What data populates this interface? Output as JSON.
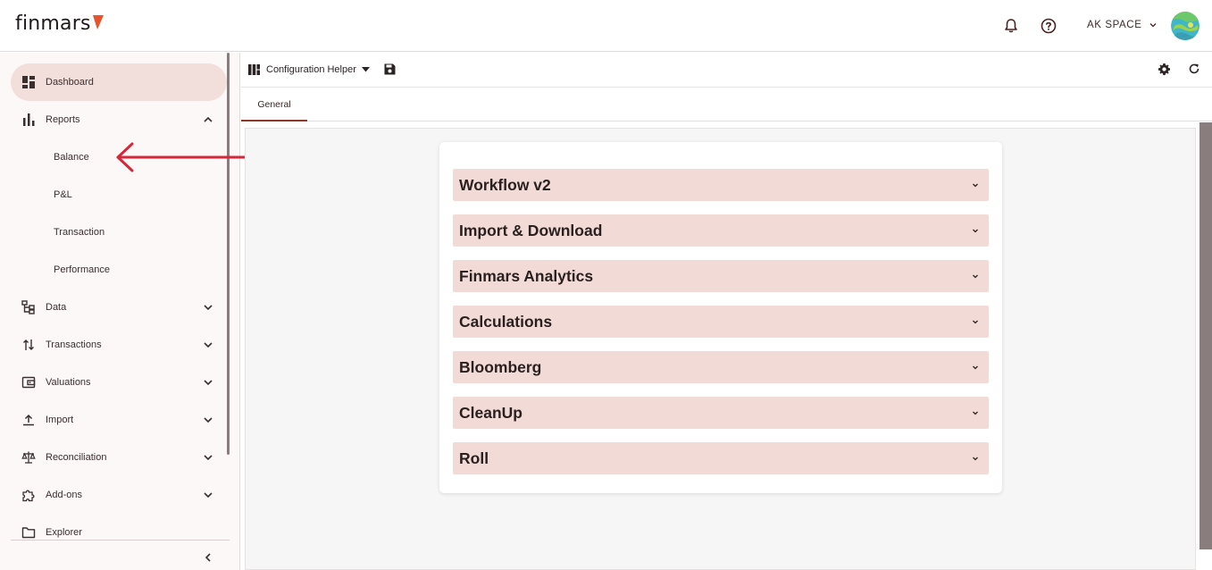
{
  "brand": {
    "logo_text": "finmars"
  },
  "header": {
    "space_name": "AK SPACE",
    "icons": [
      "bell-icon",
      "help-icon",
      "chevron-down-icon",
      "avatar"
    ]
  },
  "sidebar": {
    "items": [
      {
        "label": "Dashboard",
        "icon": "dashboard-icon",
        "active": true
      },
      {
        "label": "Reports",
        "icon": "bar-chart-icon",
        "expanded": true
      },
      {
        "label": "Data",
        "icon": "data-tree-icon"
      },
      {
        "label": "Transactions",
        "icon": "swap-vertical-icon"
      },
      {
        "label": "Valuations",
        "icon": "wallet-icon"
      },
      {
        "label": "Import",
        "icon": "upload-icon"
      },
      {
        "label": "Reconciliation",
        "icon": "scale-icon"
      },
      {
        "label": "Add-ons",
        "icon": "puzzle-icon"
      },
      {
        "label": "Explorer",
        "icon": "folder-icon"
      }
    ],
    "report_sub_items": [
      "Balance",
      "P&L",
      "Transaction",
      "Performance"
    ]
  },
  "toolbar": {
    "title": "Configuration Helper"
  },
  "tabs": [
    {
      "label": "General",
      "active": true
    }
  ],
  "accordion": {
    "sections": [
      {
        "title": "Workflow v2"
      },
      {
        "title": "Import & Download"
      },
      {
        "title": "Finmars Analytics"
      },
      {
        "title": "Calculations"
      },
      {
        "title": "Bloomberg"
      },
      {
        "title": "CleanUp"
      },
      {
        "title": "Roll"
      }
    ]
  },
  "colors": {
    "accent": "#e8522d",
    "active_bg": "#f2dedb",
    "accordion_bg": "#f2dbd7",
    "annotation_arrow": "#d7273a"
  }
}
